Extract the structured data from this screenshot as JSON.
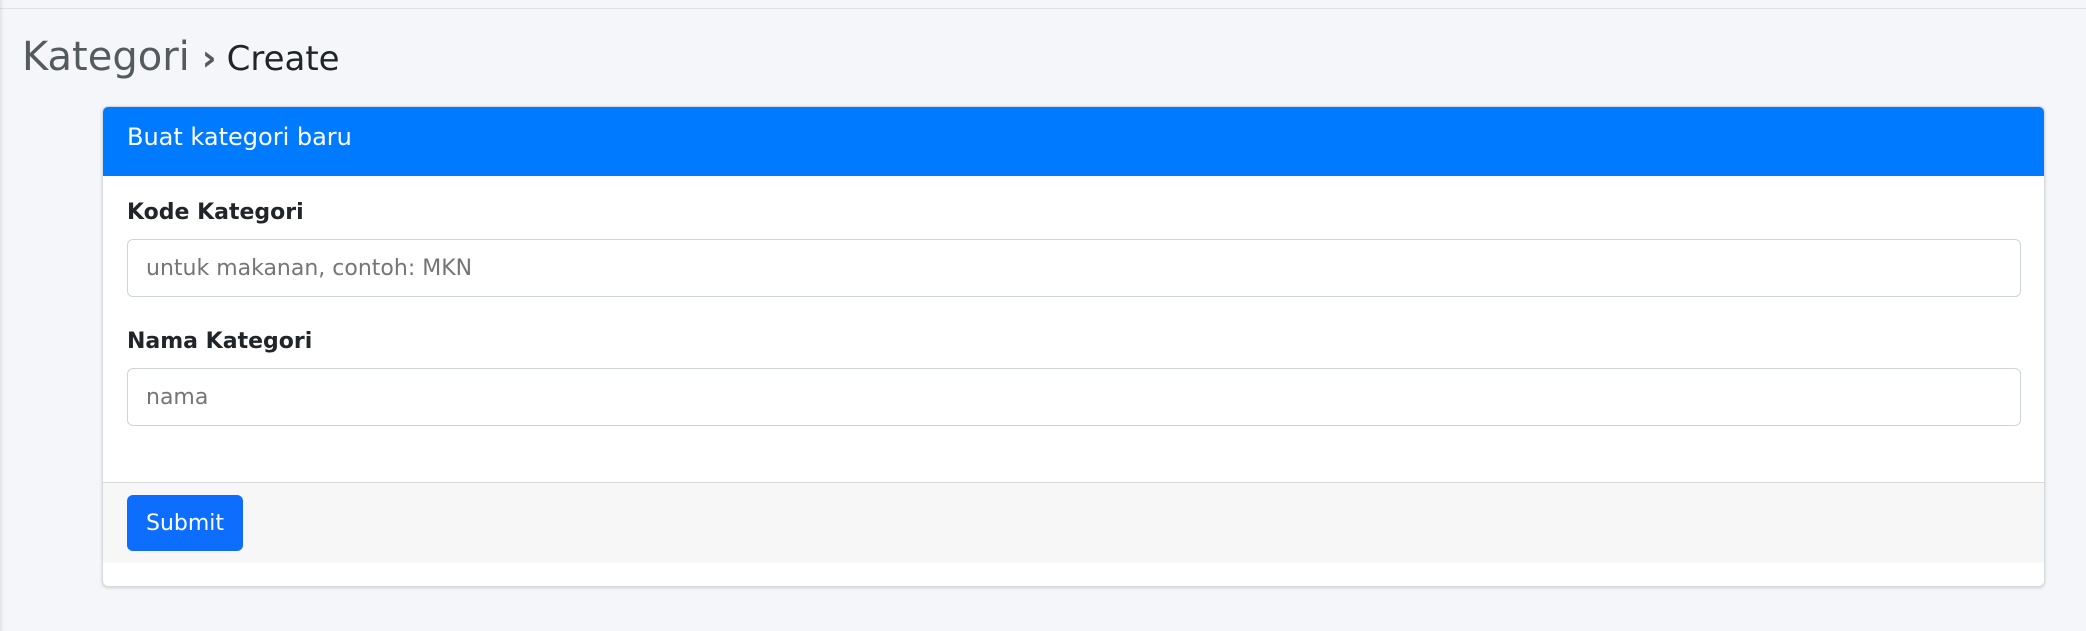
{
  "breadcrumb": {
    "section": "Kategori",
    "separator": "›",
    "page": "Create"
  },
  "card": {
    "title": "Buat kategori baru"
  },
  "form": {
    "kode": {
      "label": "Kode Kategori",
      "placeholder": "untuk makanan, contoh: MKN",
      "value": ""
    },
    "nama": {
      "label": "Nama Kategori",
      "placeholder": "nama",
      "value": ""
    },
    "submit_label": "Submit"
  },
  "colors": {
    "header": "#007bff",
    "button": "#0d6efd",
    "background": "#f4f6f9"
  }
}
